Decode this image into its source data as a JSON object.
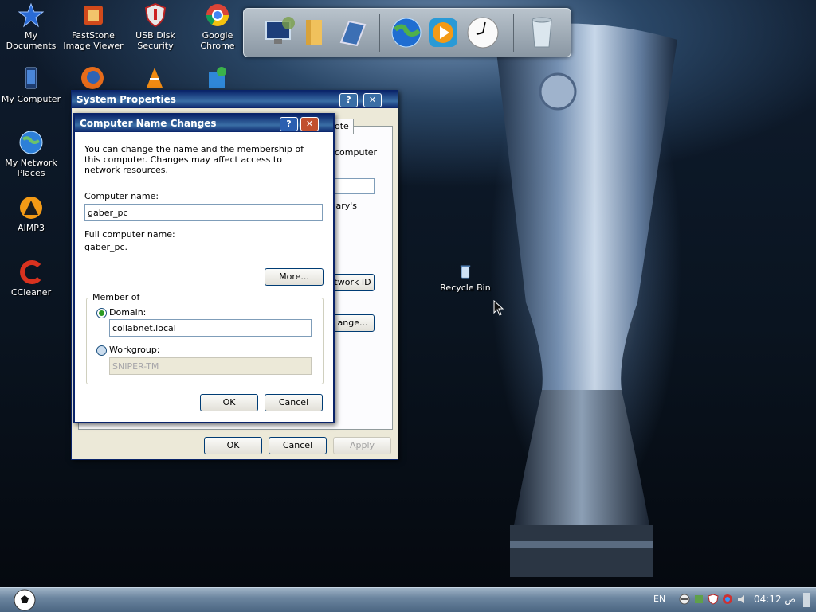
{
  "desktop": {
    "icons": [
      {
        "name": "my-documents",
        "label": "My Documents"
      },
      {
        "name": "faststone",
        "label": "FastStone Image Viewer"
      },
      {
        "name": "usb-disk-security",
        "label": "USB Disk Security"
      },
      {
        "name": "google-chrome",
        "label": "Google Chrome"
      },
      {
        "name": "my-computer",
        "label": "My Computer"
      },
      {
        "name": "my-network-places",
        "label": "My Network Places"
      },
      {
        "name": "aimp3",
        "label": "AIMP3"
      },
      {
        "name": "ccleaner",
        "label": "CCleaner"
      },
      {
        "name": "recycle-bin",
        "label": "Recycle Bin"
      }
    ],
    "dock_items": [
      "computer-icon",
      "folder-icon",
      "display-icon",
      "globe-icon",
      "media-player-icon",
      "clock-icon",
      "trash-icon"
    ]
  },
  "system_properties": {
    "title": "System Properties",
    "tab_visible": "note",
    "text_fragments": [
      "computer",
      "Mary's"
    ],
    "network_id_button": "twork ID",
    "change_button": "ange...",
    "ok": "OK",
    "cancel": "Cancel",
    "apply": "Apply"
  },
  "dialog": {
    "title": "Computer Name Changes",
    "help_btn": "?",
    "close_btn": "✕",
    "description": "You can change the name and the membership of this computer. Changes may affect access to network resources.",
    "computer_name_label": "Computer name:",
    "computer_name_value": "gaber_pc",
    "full_name_label": "Full computer name:",
    "full_name_value": "gaber_pc.",
    "more_button": "More...",
    "member_of_label": "Member of",
    "domain_label": "Domain:",
    "domain_value": "collabnet.local",
    "workgroup_label": "Workgroup:",
    "workgroup_value": "SNIPER-TM",
    "ok": "OK",
    "cancel": "Cancel",
    "selected_membership": "domain"
  },
  "taskbar": {
    "language": "EN",
    "clock_time": "04:12",
    "clock_suffix": "ص"
  },
  "colors": {
    "titlebar": "#0a246a",
    "dialog_bg": "#ece9d8",
    "close_button": "#c1502e"
  }
}
